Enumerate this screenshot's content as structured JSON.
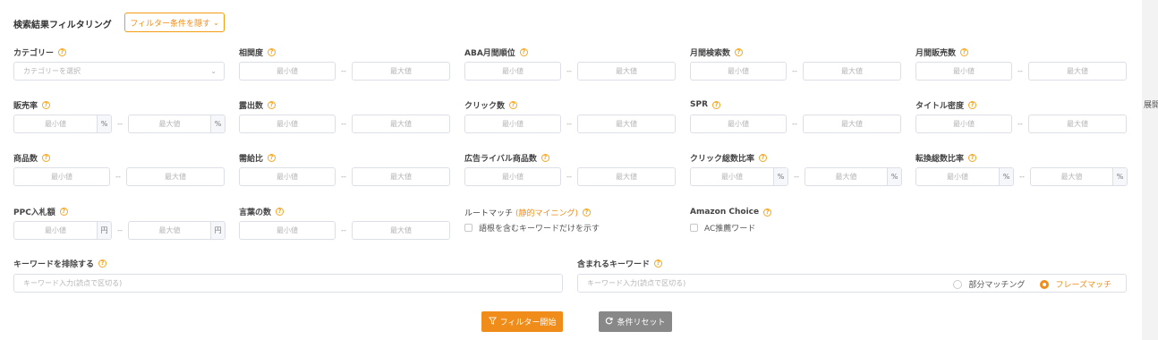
{
  "header": {
    "title": "検索結果フィルタリング",
    "hide_button": "フィルター条件を隠す",
    "hide_chevron": "⌄"
  },
  "placeholders": {
    "min": "最小値",
    "max": "最大値",
    "separator": "--"
  },
  "fields": {
    "category": {
      "label": "カテゴリー",
      "placeholder": "カテゴリーを選択"
    },
    "relevance": {
      "label": "相関度"
    },
    "aba_rank": {
      "label": "ABA月間順位"
    },
    "monthly_search": {
      "label": "月間検索数"
    },
    "monthly_sales": {
      "label": "月間販売数"
    },
    "sales_rate": {
      "label": "販売率",
      "suffix": "%"
    },
    "impressions": {
      "label": "露出数"
    },
    "clicks": {
      "label": "クリック数"
    },
    "spr": {
      "label": "SPR"
    },
    "title_density": {
      "label": "タイトル密度"
    },
    "products": {
      "label": "商品数"
    },
    "supply_demand": {
      "label": "需給比"
    },
    "ad_competitors": {
      "label": "広告ライバル商品数"
    },
    "click_share": {
      "label": "クリック総数比率",
      "suffix": "%"
    },
    "conversion_share": {
      "label": "転換総数比率",
      "suffix": "%"
    },
    "ppc_bid": {
      "label": "PPC入札額",
      "suffix": "円"
    },
    "word_count": {
      "label": "言葉の数"
    },
    "root_match": {
      "label": "ルートマッチ",
      "label_orange": "(静的マイニング)",
      "checkbox": "語根を含むキーワードだけを示す"
    },
    "amazon_choice": {
      "label": "Amazon Choice",
      "checkbox": "AC推薦ワード"
    },
    "exclude_keywords": {
      "label": "キーワードを排除する",
      "placeholder": "キーワード入力(読点で区切る)"
    },
    "include_keywords": {
      "label": "含まれるキーワード",
      "placeholder": "キーワード入力(読点で区切る)",
      "radio_partial": "部分マッチング",
      "radio_phrase": "フレーズマッチ",
      "selected": "phrase"
    }
  },
  "buttons": {
    "apply": "フィルター開始",
    "reset": "条件リセット"
  },
  "right_tab": "展開",
  "colors": {
    "accent": "#f08c1a",
    "reset_bg": "#888888"
  }
}
